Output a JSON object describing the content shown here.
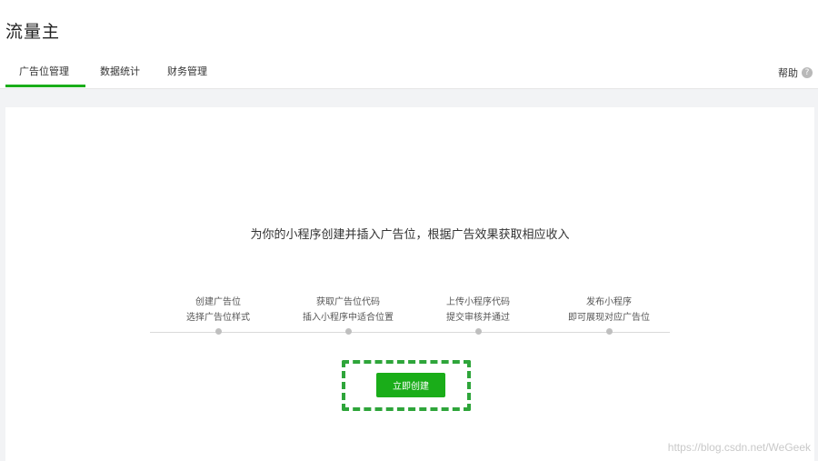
{
  "app": {
    "title": "流量主"
  },
  "tabs": [
    {
      "label": "广告位管理",
      "active": true
    },
    {
      "label": "数据统计",
      "active": false
    },
    {
      "label": "财务管理",
      "active": false
    }
  ],
  "help": {
    "label": "帮助",
    "icon": "question-circle-icon",
    "icon_glyph": "?"
  },
  "main": {
    "headline": "为你的小程序创建并插入广告位，根据广告效果获取相应收入",
    "steps": [
      {
        "title": "创建广告位",
        "desc": "选择广告位样式"
      },
      {
        "title": "获取广告位代码",
        "desc": "插入小程序中适合位置"
      },
      {
        "title": "上传小程序代码",
        "desc": "提交审核并通过"
      },
      {
        "title": "发布小程序",
        "desc": "即可展现对应广告位"
      }
    ],
    "create_button": "立即创建"
  },
  "watermark": "https://blog.csdn.net/WeGeek",
  "colors": {
    "accent": "#1aad19",
    "highlight": "#2ea53a",
    "background": "#f2f3f5"
  }
}
